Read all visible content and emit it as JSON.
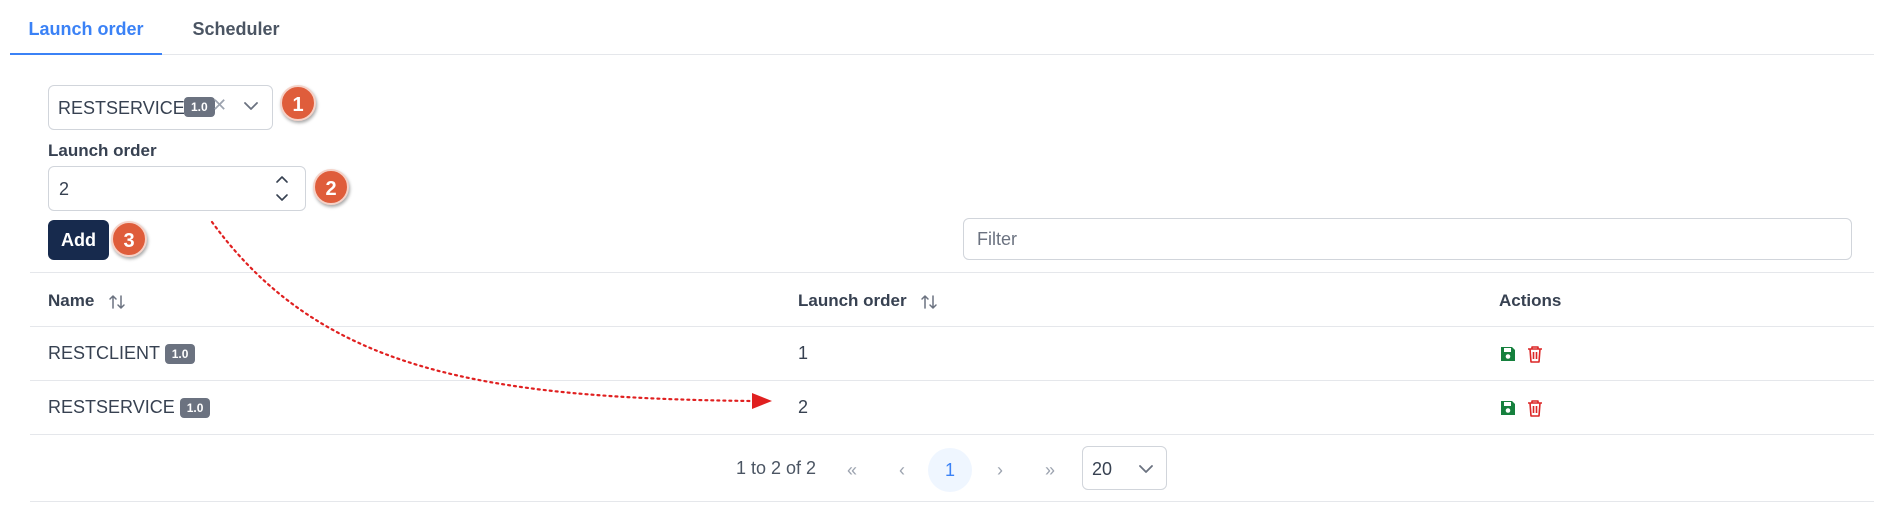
{
  "tabs": [
    {
      "label": "Launch order",
      "active": true
    },
    {
      "label": "Scheduler",
      "active": false
    }
  ],
  "service_select": {
    "value": "RESTSERVICE",
    "version": "1.0"
  },
  "launch_order_field": {
    "label": "Launch order",
    "value": "2"
  },
  "add_button": {
    "label": "Add"
  },
  "filter": {
    "placeholder": "Filter"
  },
  "markers": [
    "1",
    "2",
    "3"
  ],
  "table": {
    "columns": [
      "Name",
      "Launch order",
      "Actions"
    ],
    "rows": [
      {
        "name": "RESTCLIENT",
        "version": "1.0",
        "launch_order": "1"
      },
      {
        "name": "RESTSERVICE",
        "version": "1.0",
        "launch_order": "2"
      }
    ]
  },
  "pagination": {
    "summary": "1 to 2 of 2",
    "first": "«",
    "prev": "‹",
    "current_page": "1",
    "next": "›",
    "last": "»",
    "page_size": "20"
  },
  "icons": {
    "save": "save-icon",
    "delete": "trash-icon",
    "sort": "sort-icon"
  },
  "colors": {
    "accent": "#3b82f6",
    "primary_button": "#172a4d",
    "marker": "#df5d3b",
    "save": "#15803d",
    "delete": "#dc2626",
    "arrow": "#e02020"
  }
}
